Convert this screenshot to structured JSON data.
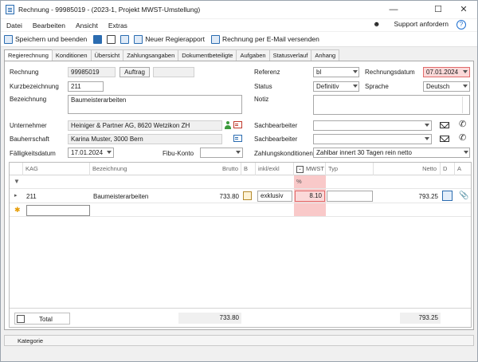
{
  "window": {
    "title": "Rechnung - 99985019 - (2023-1, Projekt MWST-Umstellung)"
  },
  "menu": {
    "items": [
      "Datei",
      "Bearbeiten",
      "Ansicht",
      "Extras"
    ],
    "support": "Support anfordern"
  },
  "toolbar": {
    "save_close": "Speichern und beenden",
    "new_report": "Neuer Regierapport",
    "email": "Rechnung per E-Mail versenden"
  },
  "tabs": [
    "Regierechnung",
    "Konditionen",
    "Übersicht",
    "Zahlungsangaben",
    "Dokumentbeteiligte",
    "Aufgaben",
    "Statusverlauf",
    "Anhang"
  ],
  "form": {
    "rechnung_label": "Rechnung",
    "rechnung_value": "99985019",
    "auftrag_label": "Auftrag",
    "kurzbez_label": "Kurzbezeichnung",
    "kurzbez_value": "211",
    "bezeichnung_label": "Bezeichnung",
    "bezeichnung_value": "Baumeisterarbeiten",
    "unternehmer_label": "Unternehmer",
    "unternehmer_value": "Heiniger & Partner AG, 8620 Wetzikon ZH",
    "bauherrschaft_label": "Bauherrschaft",
    "bauherrschaft_value": "Karina Muster, 3000 Bern",
    "faellig_label": "Fälligkeitsdatum",
    "faellig_value": "17.01.2024",
    "fibu_label": "Fibu-Konto",
    "referenz_label": "Referenz",
    "referenz_value": "bl",
    "rdatum_label": "Rechnungsdatum",
    "rdatum_value": "07.01.2024",
    "status_label": "Status",
    "status_value": "Definitiv",
    "sprache_label": "Sprache",
    "sprache_value": "Deutsch",
    "notiz_label": "Notiz",
    "sachb1_label": "Sachbearbeiter",
    "sachb2_label": "Sachbearbeiter",
    "zahlung_label": "Zahlungskonditionen",
    "zahlung_value": "Zahlbar innert 30 Tagen rein netto"
  },
  "grid": {
    "headers": {
      "kag": "KAG",
      "bez": "Bezeichnung",
      "brutto": "Brutto",
      "b": "B",
      "inkl": "inkl/exkl",
      "mwst": "MWST %",
      "typ": "Typ",
      "netto": "Netto",
      "d": "D",
      "a": "A"
    },
    "row": {
      "kag": "211",
      "bez": "Baumeisterarbeiten",
      "brutto": "733.80",
      "inkl": "exklusiv",
      "mwst": "8.10",
      "netto": "793.25"
    },
    "total": {
      "label": "Total",
      "brutto": "733.80",
      "netto": "793.25"
    }
  },
  "statusbar": {
    "label": "Kategorie"
  }
}
